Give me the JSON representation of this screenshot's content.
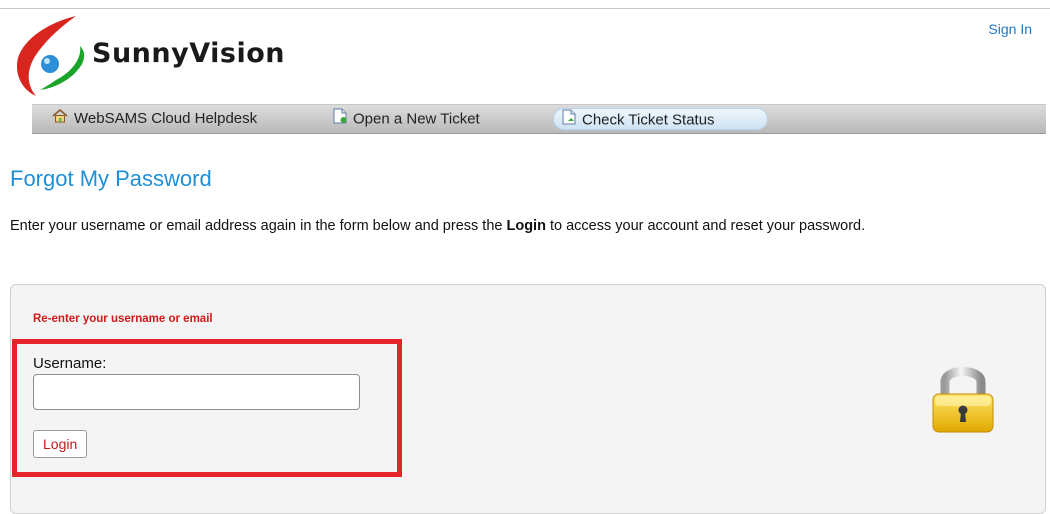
{
  "header": {
    "brand": "SunnyVision",
    "sign_in": "Sign In"
  },
  "nav": {
    "items": [
      {
        "label": "WebSAMS Cloud Helpdesk",
        "icon": "home-icon",
        "active": false
      },
      {
        "label": "Open a New Ticket",
        "icon": "new-ticket-icon",
        "active": false
      },
      {
        "label": "Check Ticket Status",
        "icon": "ticket-status-icon",
        "active": true
      }
    ]
  },
  "page": {
    "title": "Forgot My Password",
    "intro_pre": "Enter your username or email address again in the form below and press the ",
    "intro_bold": "Login",
    "intro_post": " to access your account and reset your password."
  },
  "form": {
    "error": "Re-enter your username or email",
    "username_label": "Username:",
    "username_value": "",
    "login_label": "Login"
  },
  "colors": {
    "accent": "#1e90d6",
    "error": "#d11919",
    "highlight": "#e4262c",
    "brand_green": "#1aa52a",
    "brand_red": "#d8261f"
  }
}
